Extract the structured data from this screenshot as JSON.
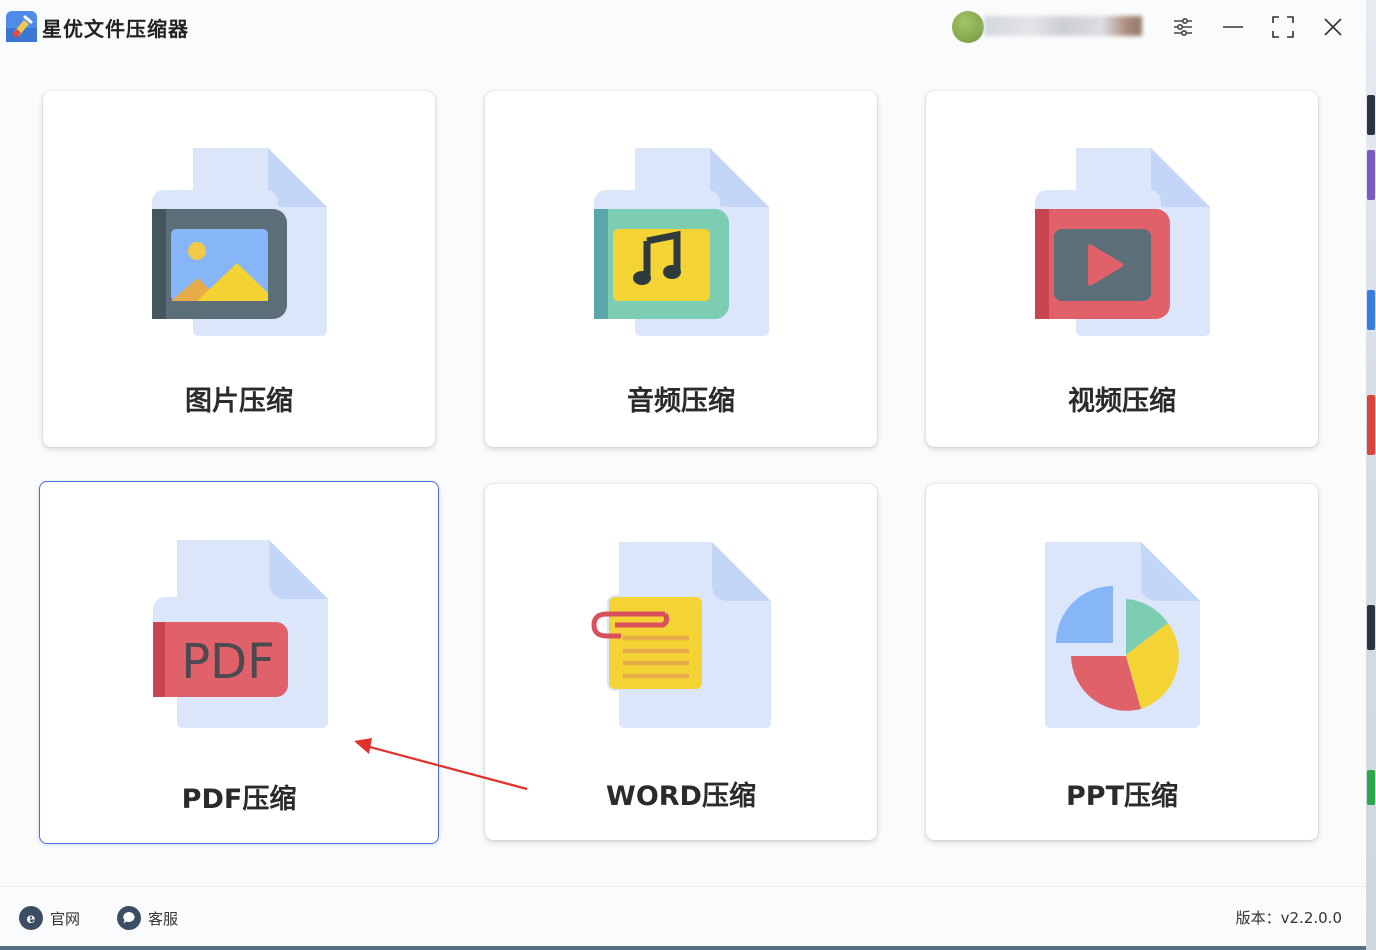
{
  "app": {
    "title": "星优文件压缩器"
  },
  "window_controls": {
    "settings_icon": "sliders-icon",
    "minimize_icon": "minimize-icon",
    "maximize_icon": "maximize-icon",
    "close_icon": "close-icon"
  },
  "cards": [
    {
      "label": "图片压缩",
      "icon": "image-file-icon"
    },
    {
      "label": "音频压缩",
      "icon": "audio-file-icon"
    },
    {
      "label": "视频压缩",
      "icon": "video-file-icon"
    },
    {
      "label": "PDF压缩",
      "icon": "pdf-file-icon",
      "selected": true
    },
    {
      "label": "WORD压缩",
      "icon": "word-file-icon"
    },
    {
      "label": "PPT压缩",
      "icon": "ppt-file-icon"
    }
  ],
  "footer": {
    "website_label": "官网",
    "support_label": "客服",
    "version": "版本：v2.2.0.0"
  },
  "colors": {
    "selected_border": "#4b6fd8",
    "annotation_arrow": "#e0312b",
    "doc_back": "#dbe6fb",
    "doc_fold": "#c4d6f7"
  }
}
